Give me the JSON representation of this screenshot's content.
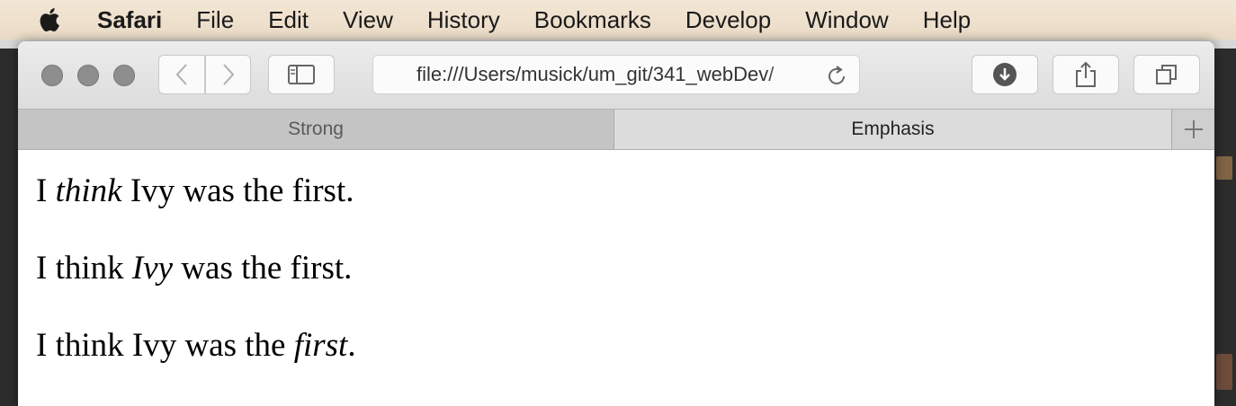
{
  "menubar": {
    "app": "Safari",
    "items": [
      "File",
      "Edit",
      "View",
      "History",
      "Bookmarks",
      "Develop",
      "Window",
      "Help"
    ]
  },
  "toolbar": {
    "url": "file:///Users/musick/um_git/341_webDev/"
  },
  "tabs": [
    {
      "label": "Strong",
      "active": false
    },
    {
      "label": "Emphasis",
      "active": true
    }
  ],
  "content": {
    "lines": [
      {
        "before": "I ",
        "em": "think",
        "after": " Ivy was the first."
      },
      {
        "before": "I think ",
        "em": "Ivy",
        "after": " was the first."
      },
      {
        "before": "I think Ivy was the ",
        "em": "first",
        "after": "."
      }
    ]
  },
  "icons": {
    "apple": "apple-icon",
    "back": "chevron-left-icon",
    "forward": "chevron-right-icon",
    "sidebar": "sidebar-icon",
    "reload": "reload-icon",
    "downloads": "download-icon",
    "share": "share-icon",
    "tabs": "tabs-overview-icon",
    "new_tab": "plus-icon"
  },
  "colors": {
    "menubar": "#efe2cf",
    "toolbar": "#e4e4e4",
    "active_tab": "#dcdcdc",
    "inactive_tab": "#c4c4c4"
  }
}
